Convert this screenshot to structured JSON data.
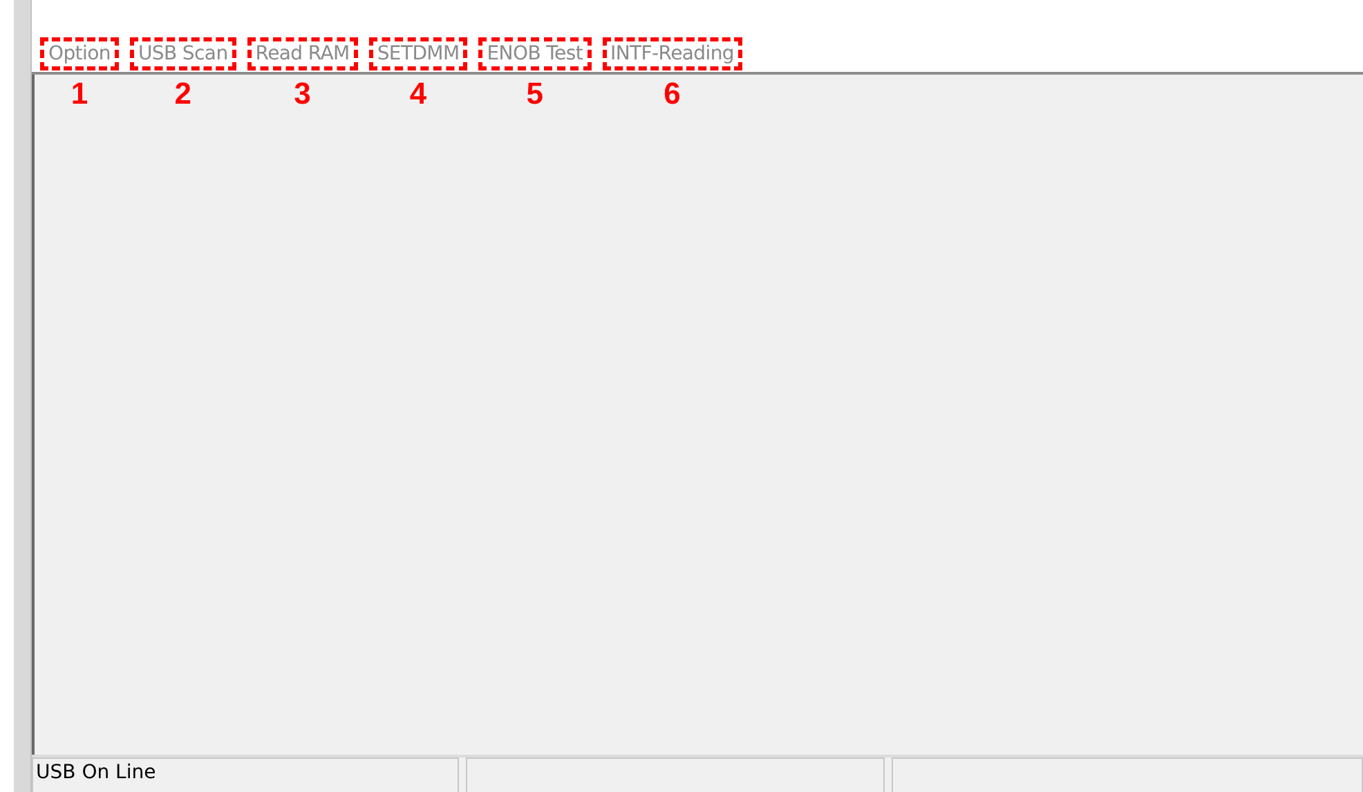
{
  "tabs": [
    {
      "label": "Option",
      "disabled": true,
      "annotation": "1"
    },
    {
      "label": "USB Scan",
      "disabled": true,
      "annotation": "2"
    },
    {
      "label": "Read RAM",
      "disabled": true,
      "annotation": "3"
    },
    {
      "label": "SETDMM",
      "disabled": true,
      "annotation": "4"
    },
    {
      "label": "ENOB Test",
      "disabled": true,
      "annotation": "5"
    },
    {
      "label": "INTF-Reading",
      "disabled": true,
      "annotation": "6"
    }
  ],
  "status_bar": [
    "USB On Line"
  ]
}
